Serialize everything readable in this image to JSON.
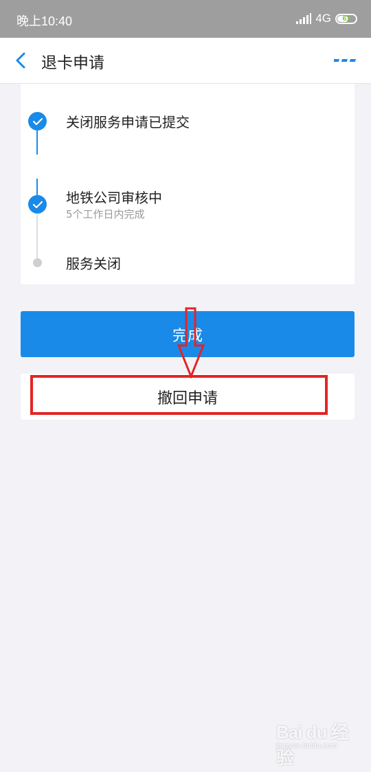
{
  "status_bar": {
    "time": "晚上10:40",
    "network": "4G",
    "battery": "61",
    "battery_level": 0.61,
    "icons": [
      "signal-icon",
      "battery-icon"
    ]
  },
  "header": {
    "title": "退卡申请",
    "back_icon": "chevron-left-icon",
    "more_icon": "more-dots-icon"
  },
  "timeline": {
    "steps": [
      {
        "title": "关闭服务申请已提交",
        "subtitle": "",
        "status": "done"
      },
      {
        "title": "地铁公司审核中",
        "subtitle": "5个工作日内完成",
        "status": "done"
      },
      {
        "title": "服务关闭",
        "subtitle": "",
        "status": "pending"
      }
    ]
  },
  "actions": {
    "done_label": "完成",
    "withdraw_label": "撤回申请"
  },
  "watermark": {
    "logo": "Bai du 经验",
    "sub": "jingyan.baidu.com"
  },
  "colors": {
    "accent": "#1a8ae8",
    "status_bar": "#9e9e9e",
    "background": "#f2f2f7",
    "annotation": "#e32424",
    "pending": "#cfcfcf"
  }
}
